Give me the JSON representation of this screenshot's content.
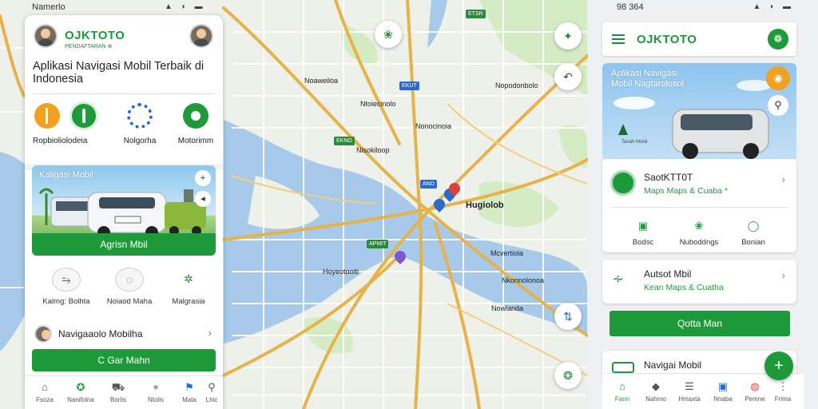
{
  "status_bar": {
    "time_left": "Namerlo",
    "time_right": "98 364",
    "icons": "▲ ◗ ▬"
  },
  "left_app": {
    "brand": "OJKTOTO",
    "brand_sub": "PENDAFTARAN ⊕",
    "title": "Aplikasi Navigasi Mobil Terbaik di Indonesia",
    "categories": [
      {
        "label": "Ropbioliolodeia",
        "icon": "pause-circle-icon",
        "color": "#f2a020"
      },
      {
        "label": "",
        "icon": "leaf-icon",
        "color": "#1f9a3a"
      },
      {
        "label": "Nolgorha",
        "icon": "network-icon",
        "color": "#1e6fd0"
      },
      {
        "label": "Motorimm",
        "icon": "gear-icon",
        "color": "#1f9a3a"
      }
    ],
    "banner": {
      "label": "Kaligasi Mobil",
      "button": "Agrisn Mbil",
      "controls": [
        "+",
        "◂"
      ]
    },
    "chips": [
      {
        "label": "Kalmg: Bolhta",
        "icon": "car-route-icon",
        "glyph": "⥲"
      },
      {
        "label": "Noiaod Maha",
        "icon": "shield-icon",
        "glyph": "◌"
      },
      {
        "label": "Malgrasia",
        "icon": "gear-icon",
        "glyph": "✲"
      }
    ],
    "row_label": "Navigaaolo Mobilha",
    "green_button": "C Gar Mahn",
    "tabs": [
      {
        "label": "Fsoza",
        "icon": "home-icon",
        "glyph": "⌂"
      },
      {
        "label": "Nanifolna",
        "icon": "navigation-icon",
        "glyph": "✪"
      },
      {
        "label": "Borlis",
        "icon": "location-icon",
        "glyph": "⛟"
      },
      {
        "label": "Ntolis",
        "icon": "pin-icon",
        "glyph": "⌖"
      },
      {
        "label": "Mata",
        "icon": "bookmark-icon",
        "glyph": "⚑"
      },
      {
        "label": "Lhic",
        "icon": "profile-icon",
        "glyph": "⚲"
      }
    ]
  },
  "map": {
    "labels": [
      "Noaweiloa",
      "Ntoiecinolo",
      "Nonocinoia",
      "Nopodonbolo",
      "Nisokiloop",
      "Hoyeotooiti",
      "Mcvertiola",
      "Nkonnolonoa",
      "Nowlanda",
      "Hugiolob"
    ],
    "badges": [
      "ETSR",
      "EKUT",
      "EKNO",
      "AND",
      "APMIT"
    ],
    "buttons": [
      "compass-icon",
      "directions-icon",
      "leaf-icon",
      "route-icon",
      "plus-icon"
    ]
  },
  "right_app": {
    "brand": "OJKTOTO",
    "hero_label": "Aplikasi Navigasi Mobil Nagtarolosol",
    "hero_small": "Tanah Mobil",
    "card1": {
      "title": "SaotKTT0T",
      "sub": "Maps Maps & Cuaba *",
      "mini": [
        "Bodsc",
        "Nuboddngs",
        "Bonian"
      ]
    },
    "card2": {
      "title": "Autsot Mbil",
      "sub": "Kean Maps & Cuatha"
    },
    "green_button": "Qotta Man",
    "card3_title": "Navigai Mobil",
    "fab": "+",
    "tabs": [
      {
        "label": "Fann",
        "icon": "home-icon",
        "glyph": "⌂"
      },
      {
        "label": "Nahmo",
        "icon": "diamond-icon",
        "glyph": "◆"
      },
      {
        "label": "Hmaxta",
        "icon": "list-icon",
        "glyph": "☰"
      },
      {
        "label": "Nnaba",
        "icon": "building-icon",
        "glyph": "▣"
      },
      {
        "label": "Pemne",
        "icon": "globe-icon",
        "glyph": "◍"
      },
      {
        "label": "Frima",
        "icon": "more-icon",
        "glyph": "⋮"
      }
    ]
  },
  "colors": {
    "brand_green": "#1f9a3a",
    "water": "#a7c9ea",
    "road": "#e6b34a",
    "accent_orange": "#f2a020"
  }
}
